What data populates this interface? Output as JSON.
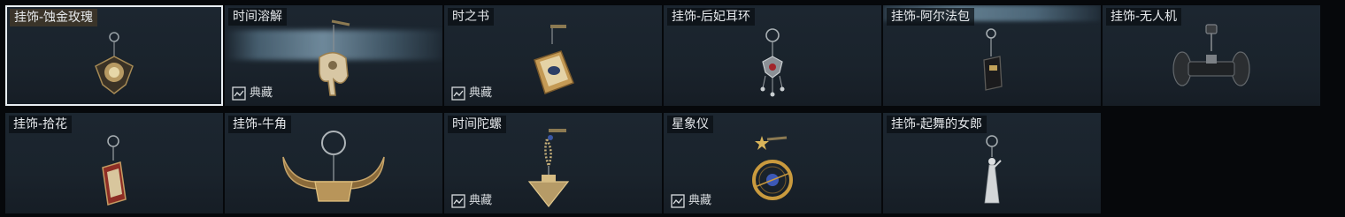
{
  "items": [
    {
      "name": "挂饰-蚀金玫瑰",
      "badge": ""
    },
    {
      "name": "时间溶解",
      "badge": "典藏"
    },
    {
      "name": "时之书",
      "badge": "典藏"
    },
    {
      "name": "挂饰-后妃耳环",
      "badge": ""
    },
    {
      "name": "挂饰-阿尔法包",
      "badge": ""
    },
    {
      "name": "挂饰-无人机",
      "badge": ""
    },
    {
      "name": "挂饰-拾花",
      "badge": ""
    },
    {
      "name": "挂饰-牛角",
      "badge": ""
    },
    {
      "name": "时间陀螺",
      "badge": "典藏"
    },
    {
      "name": "星象仪",
      "badge": "典藏"
    },
    {
      "name": "挂饰-起舞的女郎",
      "badge": ""
    }
  ],
  "icons": {
    "badge": "collection-icon"
  },
  "colors": {
    "selected_outline": "#e8eef3",
    "tile_bg": "#1c2630",
    "page_bg": "#06080b"
  }
}
